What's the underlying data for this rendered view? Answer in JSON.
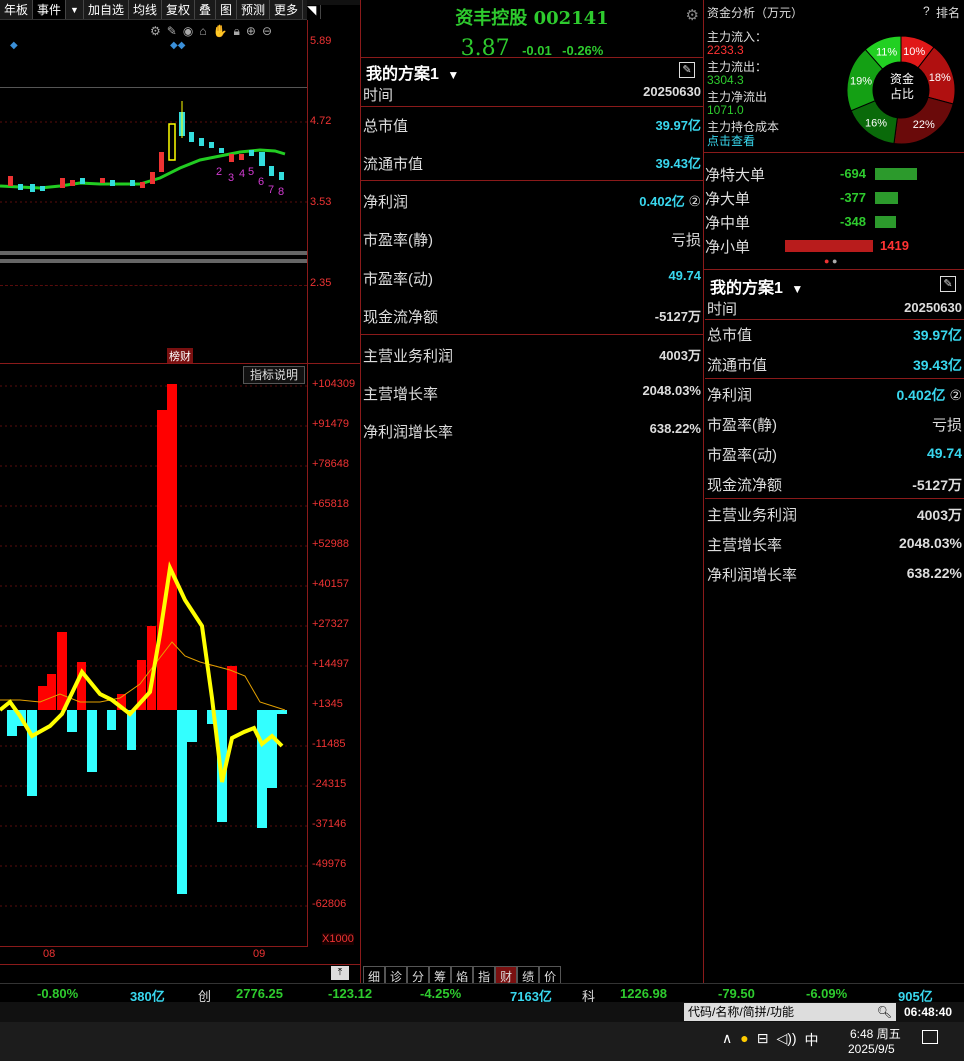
{
  "toolbar": {
    "items": [
      "年板",
      "事件",
      "加自选",
      "均线",
      "复权",
      "叠",
      "图",
      "预测",
      "更多"
    ],
    "expand_icon": "chevron-down-icon",
    "right_icon": "arrow-icon"
  },
  "stock": {
    "name": "资丰控股",
    "code": "002141",
    "price": "3.87",
    "change": "-0.01",
    "change_pct": "-0.26%"
  },
  "kline": {
    "price_levels": [
      "5.89",
      "4.72",
      "3.53",
      "2.35"
    ],
    "nums": [
      "2",
      "3",
      "4",
      "5",
      "6",
      "7",
      "8"
    ],
    "marker": "榜财"
  },
  "indicator": {
    "button": "指标说明",
    "levels": [
      "+104309",
      "+91479",
      "+78648",
      "+65818",
      "+52988",
      "+40157",
      "+27327",
      "+14497",
      "+1345",
      "-11485",
      "-24315",
      "-37146",
      "-49976",
      "-62806"
    ],
    "multiplier": "X1000",
    "x_labels": [
      "08",
      "09"
    ]
  },
  "fin": {
    "title": "我的方案1",
    "time_label": "时间",
    "time_value": "20250630",
    "rows": [
      {
        "label": "总市值",
        "value": "39.97亿"
      },
      {
        "label": "流通市值",
        "value": "39.43亿"
      },
      {
        "label": "净利润",
        "value": "0.402亿"
      },
      {
        "label": "市盈率(静)",
        "value": "亏损"
      },
      {
        "label": "市盈率(动)",
        "value": "49.74"
      },
      {
        "label": "现金流净额",
        "value": "-5127万"
      },
      {
        "label": "主营业务利润",
        "value": "4003万"
      },
      {
        "label": "主营增长率",
        "value": "2048.03%"
      },
      {
        "label": "净利润增长率",
        "value": "638.22%"
      }
    ],
    "circled": "②"
  },
  "tabs": [
    "细",
    "诊",
    "分",
    "筹",
    "焰",
    "指",
    "财",
    "绩",
    "价"
  ],
  "fund": {
    "title": "资金分析（万元）",
    "help": "?",
    "rank": "排名",
    "inflow_label": "主力流入：",
    "inflow": "2233.3",
    "outflow_label": "主力流出：",
    "outflow": "3304.3",
    "net_label": "主力净流出",
    "net": "1071.0",
    "cost_label": "主力持仓成本",
    "link": "点击查看",
    "donut_center": "资金占比",
    "slices": [
      {
        "pct": "10%",
        "color": "#e01818"
      },
      {
        "pct": "18%",
        "color": "#b01010"
      },
      {
        "pct": "22%",
        "color": "#6a0a0a"
      },
      {
        "pct": "16%",
        "color": "#0a6a0a"
      },
      {
        "pct": "19%",
        "color": "#14a014"
      },
      {
        "pct": "11%",
        "color": "#22d022"
      }
    ],
    "flows": [
      {
        "label": "净特大单",
        "value": "-694"
      },
      {
        "label": "净大单",
        "value": "-377"
      },
      {
        "label": "净中单",
        "value": "-348"
      },
      {
        "label": "净小单",
        "value": "1419"
      }
    ]
  },
  "market": {
    "items": [
      "-0.80%",
      "380亿",
      "创",
      "2776.25",
      "-123.12",
      "-4.25%",
      "7163亿",
      "科",
      "1226.98",
      "-79.50",
      "-6.09%",
      "905亿"
    ]
  },
  "search": {
    "placeholder": "代码/名称/简拼/功能",
    "clock": "06:48:40"
  },
  "taskbar": {
    "time": "6:48 周五",
    "date": "2025/9/5",
    "ime": "中"
  }
}
